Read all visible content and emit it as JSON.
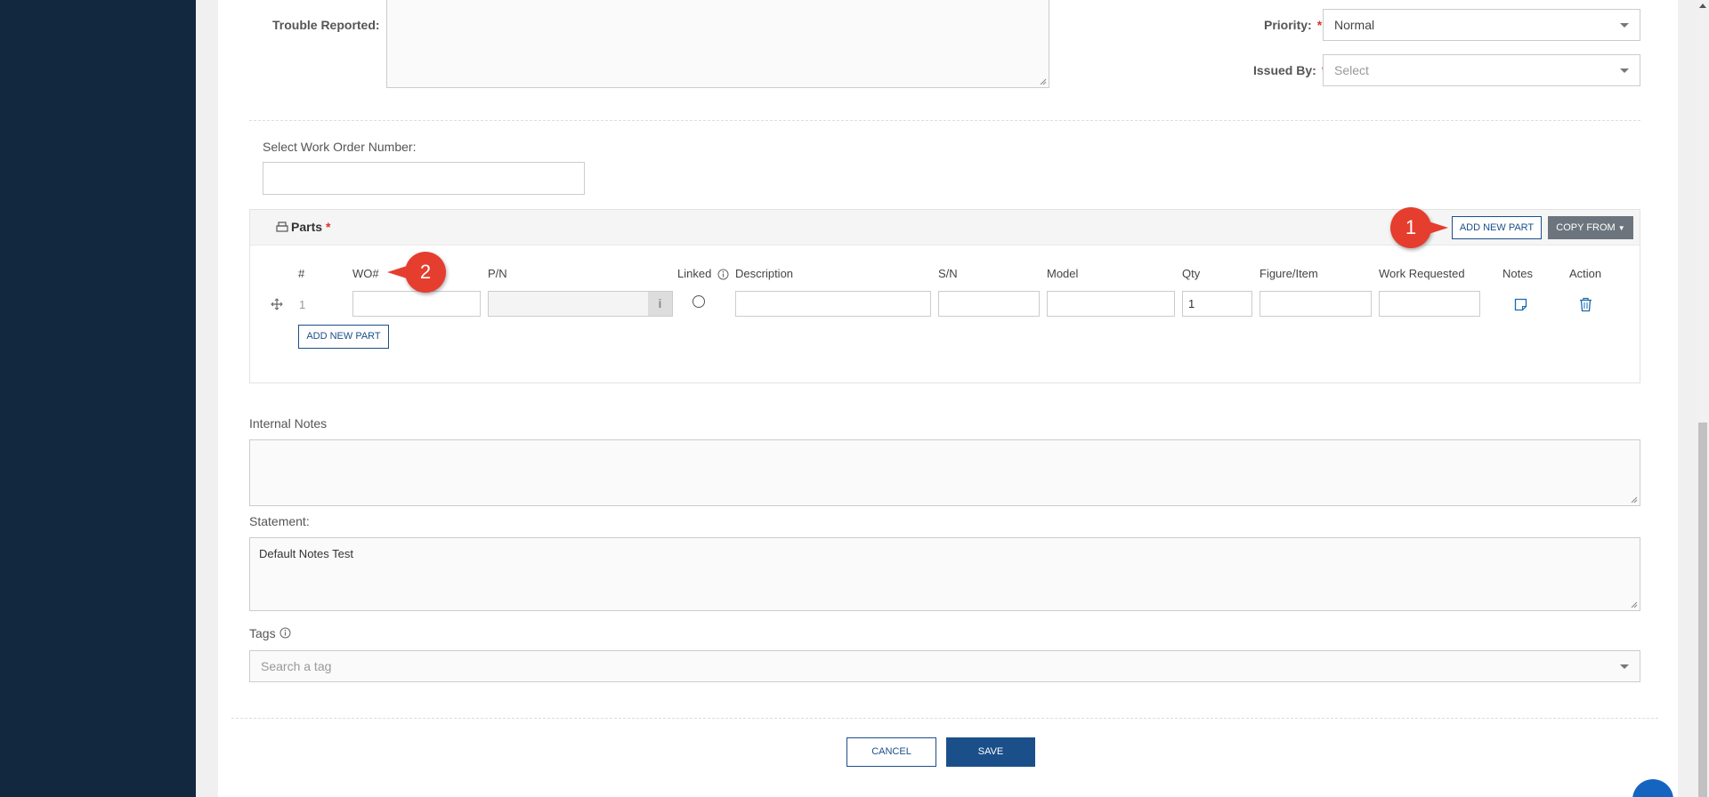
{
  "form": {
    "trouble_reported_label": "Trouble Reported:",
    "priority_label": "Priority:",
    "priority_value": "Normal",
    "issued_by_label": "Issued By:",
    "issued_by_placeholder": "Select",
    "required_mark": "*",
    "wo_number_label": "Select Work Order Number:"
  },
  "parts": {
    "title": "Parts",
    "add_new_part_top": "ADD NEW PART",
    "copy_from": "COPY FROM",
    "columns": [
      "#",
      "WO#",
      "P/N",
      "Linked",
      "Description",
      "S/N",
      "Model",
      "Qty",
      "Figure/Item",
      "Work Requested",
      "Notes",
      "Action"
    ],
    "rows": [
      {
        "index": "1",
        "wo": "",
        "pn": "",
        "description": "",
        "sn": "",
        "model": "",
        "qty": "1",
        "figure_item": "",
        "work_requested": ""
      }
    ],
    "add_new_part_bottom": "ADD NEW PART"
  },
  "internal_notes": {
    "label": "Internal Notes",
    "value": ""
  },
  "statement": {
    "label": "Statement:",
    "value": "Default Notes Test"
  },
  "tags": {
    "label": "Tags",
    "placeholder": "Search a tag"
  },
  "footer": {
    "cancel": "CANCEL",
    "save": "SAVE"
  },
  "annotations": {
    "marker1": "1",
    "marker2": "2"
  },
  "colors": {
    "sidebar": "#12283f",
    "primary": "#1b4f8a",
    "required": "#d9312b",
    "marker": "#e53d2e"
  }
}
